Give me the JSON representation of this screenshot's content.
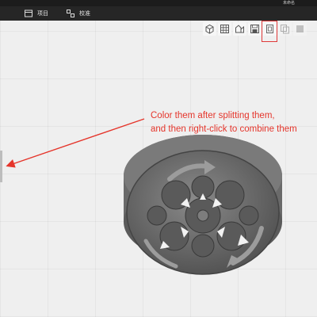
{
  "window": {
    "account_label": "未命名"
  },
  "menubar": {
    "items": [
      {
        "label": "项目",
        "icon": "project-icon"
      },
      {
        "label": "校准",
        "icon": "calibrate-icon"
      }
    ]
  },
  "toolbar": {
    "buttons": [
      {
        "icon": "cube-view-icon"
      },
      {
        "icon": "grid-layout-icon"
      },
      {
        "icon": "split-objects-icon"
      },
      {
        "icon": "save-layout-icon"
      },
      {
        "icon": "split-parts-icon",
        "highlighted": true
      },
      {
        "icon": "combine-icon",
        "disabled": true
      },
      {
        "icon": "model-box-icon",
        "disabled": true
      }
    ]
  },
  "annotation": {
    "line1": "Color them after splitting them,",
    "line2": "and then right-click to combine them",
    "color": "#e5352b"
  },
  "model": {
    "name": "gear-model",
    "color": "#5f5f5f"
  }
}
